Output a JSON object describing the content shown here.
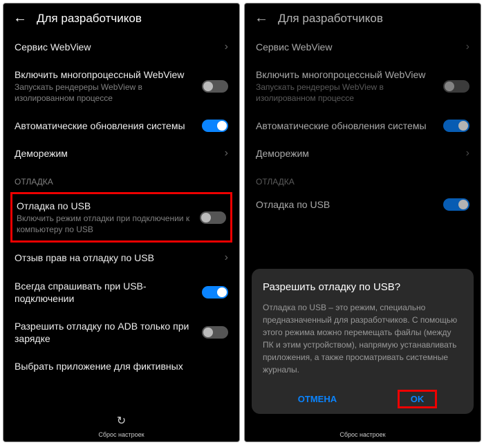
{
  "header": {
    "title": "Для разработчиков"
  },
  "left": {
    "webview": {
      "label": "Сервис WebView"
    },
    "multiwebview": {
      "label": "Включить многопроцессный WebView",
      "sub": "Запускать рендереры WebView в изолированном процессе"
    },
    "autoupdate": {
      "label": "Автоматические обновления системы"
    },
    "demo": {
      "label": "Деморежим"
    },
    "section_debug": "ОТЛАДКА",
    "usb_debug": {
      "label": "Отладка по USB",
      "sub": "Включить режим отладки при подключении к компьютеру по USB"
    },
    "revoke": {
      "label": "Отзыв прав на отладку по USB"
    },
    "always_ask": {
      "label": "Всегда спрашивать при USB-подключении"
    },
    "adb_charging": {
      "label": "Разрешить отладку по ADB только при зарядке"
    },
    "mock_app": {
      "label": "Выбрать приложение для фиктивных"
    },
    "footer": "Сброс настроек"
  },
  "right": {
    "webview": {
      "label": "Сервис WebView"
    },
    "multiwebview": {
      "label": "Включить многопроцессный WebView",
      "sub": "Запускать рендереры WebView в изолированном процессе"
    },
    "autoupdate": {
      "label": "Автоматические обновления системы"
    },
    "demo": {
      "label": "Деморежим"
    },
    "section_debug": "ОТЛАДКА",
    "usb_debug": {
      "label": "Отладка по USB"
    },
    "footer": "Сброс настроек"
  },
  "dialog": {
    "title": "Разрешить отладку по USB?",
    "body": "Отладка по USB – это режим, специально предназначенный для разработчиков. С помощью этого режима можно перемещать файлы (между ПК и этим устройством), напрямую устанавливать приложения, а также просматривать системные журналы.",
    "cancel": "ОТМЕНА",
    "ok": "OK"
  }
}
